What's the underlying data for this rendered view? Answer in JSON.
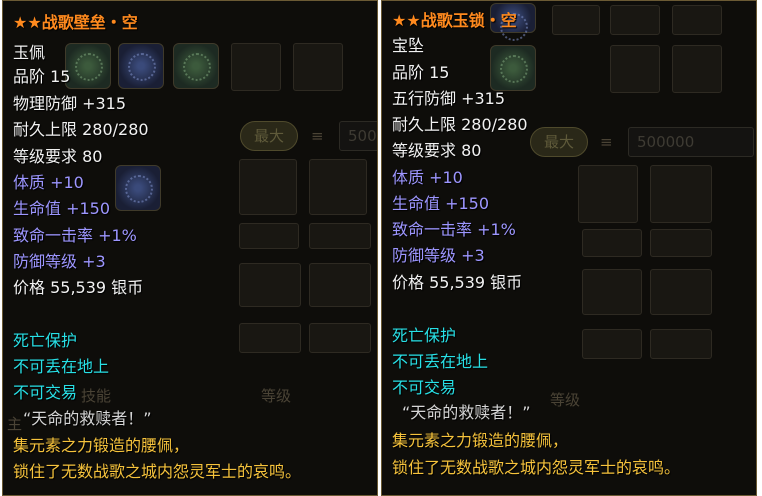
{
  "background_labels": {
    "max_button": "最大",
    "quantity_value": "500000",
    "quantity_value_partial": "500",
    "skill_partial": "技能",
    "level": "等级",
    "main_partial": "主"
  },
  "tooltips": [
    {
      "title": "★★战歌壁垒・空",
      "slot_type": "玉佩",
      "grade": "品阶 15",
      "main_stat": "物理防御 +315",
      "durability": "耐久上限 280/280",
      "level_req": "等级要求 80",
      "bonus_stats": [
        "体质 +10",
        "生命值 +150",
        "致命一击率 +1%",
        "防御等级 +3"
      ],
      "price": "价格 55,539 银币",
      "bindings": [
        "死亡保护",
        "不可丢在地上",
        "不可交易"
      ],
      "quote": "“天命的救赎者！”",
      "lore": [
        "集元素之力锻造的腰佩，",
        "锁住了无数战歌之城内怨灵军士的哀鸣。"
      ]
    },
    {
      "title": "★★战歌玉锁・空",
      "slot_type": "宝坠",
      "grade": "品阶 15",
      "main_stat": "五行防御 +315",
      "durability": "耐久上限 280/280",
      "level_req": "等级要求 80",
      "bonus_stats": [
        "体质 +10",
        "生命值 +150",
        "致命一击率 +1%",
        "防御等级 +3"
      ],
      "price": "价格 55,539 银币",
      "bindings": [
        "死亡保护",
        "不可丢在地上",
        "不可交易"
      ],
      "quote": "“天命的救赎者！”",
      "lore": [
        "集元素之力锻造的腰佩，",
        "锁住了无数战歌之城内怨灵军士的哀鸣。"
      ]
    }
  ]
}
